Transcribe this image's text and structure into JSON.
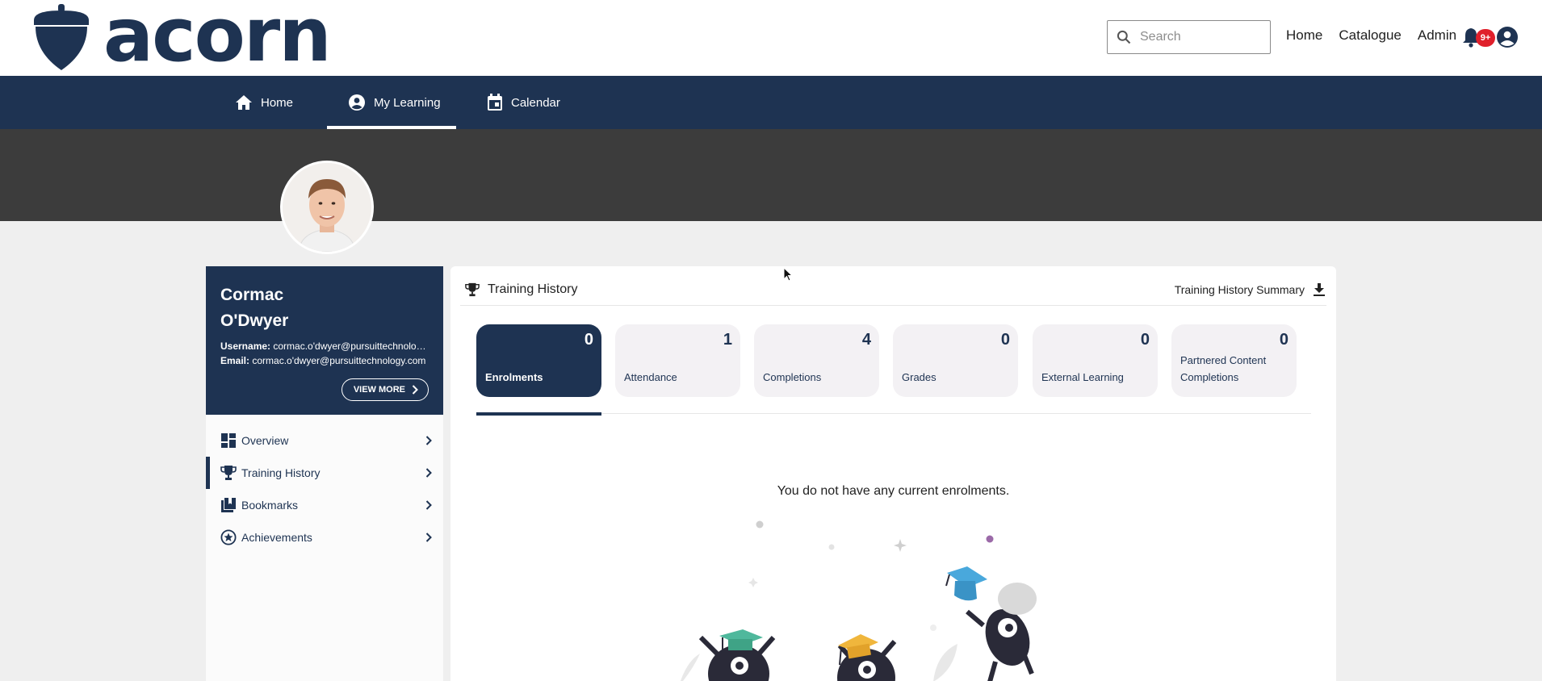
{
  "brand": {
    "name": "acorn",
    "color": "#1e3352"
  },
  "header": {
    "search_placeholder": "Search",
    "links": [
      "Home",
      "Catalogue",
      "Admin"
    ],
    "notifications_badge": "9+"
  },
  "nav": {
    "items": [
      {
        "label": "Home",
        "icon": "home-icon"
      },
      {
        "label": "My Learning",
        "icon": "account-circle-icon",
        "active": true
      },
      {
        "label": "Calendar",
        "icon": "calendar-icon"
      }
    ]
  },
  "profile": {
    "first_name": "Cormac",
    "last_name": "O'Dwyer",
    "username_label": "Username:",
    "username": "cormac.o'dwyer@pursuittechnology...",
    "email_label": "Email:",
    "email": "cormac.o'dwyer@pursuittechnology.com",
    "view_more": "VIEW MORE"
  },
  "sidebar": {
    "items": [
      {
        "label": "Overview",
        "icon": "dashboard-icon"
      },
      {
        "label": "Training History",
        "icon": "trophy-icon",
        "active": true
      },
      {
        "label": "Bookmarks",
        "icon": "bookmarks-icon"
      },
      {
        "label": "Achievements",
        "icon": "star-badge-icon"
      }
    ]
  },
  "panel": {
    "title": "Training History",
    "summary_link": "Training History Summary",
    "tiles": [
      {
        "count": "0",
        "label": "Enrolments",
        "active": true
      },
      {
        "count": "1",
        "label": "Attendance"
      },
      {
        "count": "4",
        "label": "Completions"
      },
      {
        "count": "0",
        "label": "Grades"
      },
      {
        "count": "0",
        "label": "External Learning"
      },
      {
        "count": "0",
        "label": "Partnered Content Completions"
      }
    ],
    "empty_message": "You do not have any current enrolments."
  },
  "colors": {
    "primary": "#1e3352",
    "banner": "#3c3c3c",
    "badge": "#e0202b",
    "tile_bg": "#f3f1f4"
  }
}
